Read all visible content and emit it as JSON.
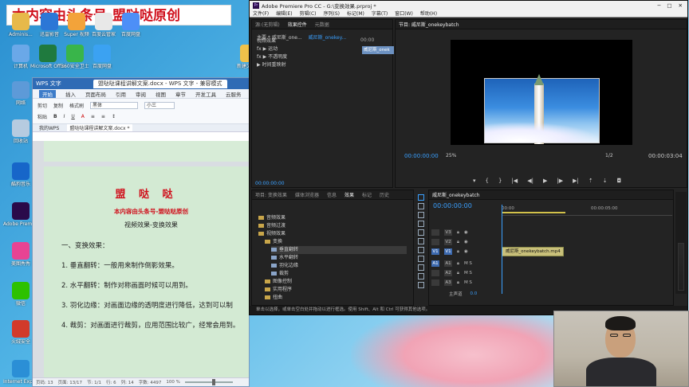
{
  "banner": "本内容由头条号-盟哒哒原创",
  "desktop_icons": [
    {
      "label": "Adminis...",
      "icon": "user-folder-icon",
      "color": "#e7b94a"
    },
    {
      "label": "迅雷影音",
      "icon": "thunder-icon",
      "color": "#2c77d6"
    },
    {
      "label": "Super 视频",
      "icon": "super-video-icon",
      "color": "#f3a33a"
    },
    {
      "label": "百度云管家",
      "icon": "baidu-icon",
      "color": "#e8e8e8"
    },
    {
      "label": "百度网盘",
      "icon": "baidu-pan-icon",
      "color": "#4d8ff7"
    },
    {
      "label": "计算机",
      "icon": "computer-icon",
      "color": "#6aa8e8"
    },
    {
      "label": "Microsoft Office...",
      "icon": "excel-icon",
      "color": "#1f7a3e"
    },
    {
      "label": "360安全卫士",
      "icon": "shield-360-icon",
      "color": "#39b54a"
    },
    {
      "label": "百度网盘",
      "icon": "cloud-icon",
      "color": "#3ba2f2"
    },
    {
      "label": "网络",
      "icon": "network-icon",
      "color": "#5d9ad8"
    },
    {
      "label": "回收站",
      "icon": "recycle-bin-icon",
      "color": "#b6cbe0"
    },
    {
      "label": "酷狗音乐",
      "icon": "kugou-icon",
      "color": "#1766c9"
    },
    {
      "label": "Adobe Premiere",
      "icon": "premiere-icon",
      "color": "#2a0a4a"
    },
    {
      "label": "美图秀秀",
      "icon": "meitu-icon",
      "color": "#e84393"
    },
    {
      "label": "微信",
      "icon": "wechat-icon",
      "color": "#2dc100"
    },
    {
      "label": "火绒安全",
      "icon": "huorong-icon",
      "color": "#d23a2a"
    },
    {
      "label": "Internet Explorer",
      "icon": "ie-icon",
      "color": "#2b8fd6"
    },
    {
      "label": "新建文件夹",
      "icon": "folder-icon",
      "color": "#f0c24a"
    }
  ],
  "wps": {
    "app": "WPS 文字",
    "doc_tab": "盟哒哒课程讲解文案.docx - WPS 文字 - 兼容模式",
    "menu": [
      "开始",
      "插入",
      "页面布局",
      "引用",
      "审阅",
      "视图",
      "章节",
      "开发工具",
      "云服务"
    ],
    "tools": {
      "cut": "剪切",
      "copy": "复制",
      "format_painter": "格式刷",
      "paste": "粘贴",
      "font": "黑体",
      "size": "小三"
    },
    "tabs": [
      "我的WPS",
      "盟哒哒课程讲解文案.docx *"
    ],
    "doc": {
      "title": "盟 哒 哒",
      "subtitle": "本内容由头条号-盟哒哒原创",
      "subtitle2": "视频效果-变换效果",
      "section": "一、变换效果：",
      "items": [
        "1. 垂直翻转：一般用来制作倒影效果。",
        "2. 水平翻转：制作对称画面时候可以用到。",
        "3. 羽化边缘：对画面边缘的透明度进行降低，达到可以制",
        "4. 裁剪：对画面进行裁剪，应用范围比较广，经常会用到。"
      ]
    },
    "status": {
      "page": "页码: 13",
      "pages": "页面: 13/17",
      "section": "节: 1/1",
      "line": "行: 6",
      "col": "列: 14",
      "words": "字数: 4497",
      "zoom": "100 %"
    }
  },
  "premiere": {
    "title": "Adobe Premiere Pro CC - G:\\变换效果.prproj *",
    "menu": [
      "文件(F)",
      "编辑(E)",
      "剪辑(C)",
      "序列(S)",
      "标记(M)",
      "字幕(T)",
      "窗口(W)",
      "帮助(H)"
    ],
    "source_tabs": [
      "源:(无剪辑)",
      "效果控件",
      "元数据"
    ],
    "effect_controls": {
      "master": "主要 * 威尼斯_one...",
      "seq": "威尼斯_onekey...",
      "clip_label": "威尼斯_onek",
      "time": "00:00",
      "header": "视频效果",
      "rows": [
        "fx ▶ 运动",
        "fx ▶ 不透明度",
        "▶ 时间重映射"
      ],
      "timecode": "00:00:00:00"
    },
    "program": {
      "tab": "节目: 威尼斯_onekeybatch",
      "timecode_left": "00:00:00:00",
      "zoom": "25%",
      "quality": "1/2",
      "timecode_right": "00:00:03:04"
    },
    "project_tabs": [
      "项目: 变换效果",
      "媒体浏览器",
      "信息",
      "效果",
      "标记",
      "历史"
    ],
    "effects_tree": [
      "音频效果",
      "音频过渡",
      "视频效果",
      "变换",
      "垂直翻转",
      "水平翻转",
      "羽化边缘",
      "裁剪",
      "图像控制",
      "实用程序",
      "扭曲"
    ],
    "timeline": {
      "tab": "威尼斯_onekeybatch",
      "timecode": "00:00:00:00",
      "ruler_start": "00:00",
      "ruler_mark": "00:00:05:00",
      "tracks": [
        "V3",
        "V2",
        "V1",
        "A1",
        "A2",
        "A3"
      ],
      "master": "主声道",
      "master_val": "0.0",
      "clip": "威尼斯_onekeybatch.mp4"
    },
    "status": "单击以选择，或单击空白处并拖动以进行框选。使用 Shift、Alt 和 Ctrl 可获得其他选项。"
  }
}
